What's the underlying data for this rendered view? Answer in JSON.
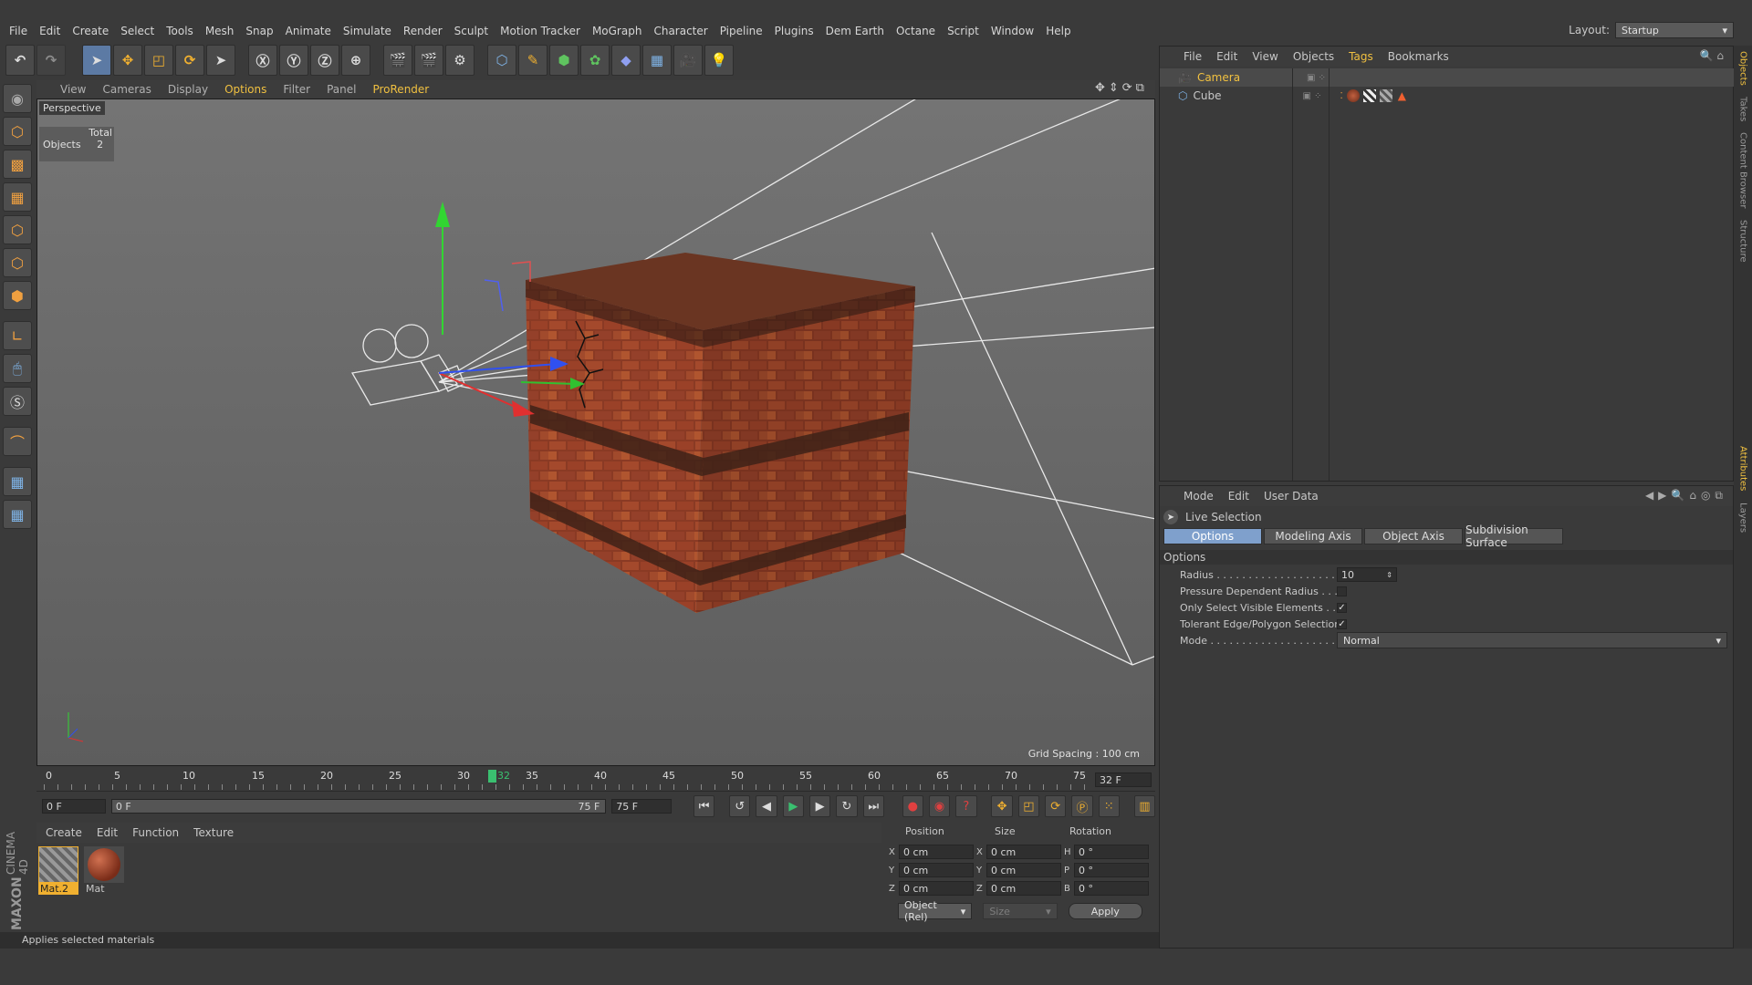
{
  "menu": [
    "File",
    "Edit",
    "Create",
    "Select",
    "Tools",
    "Mesh",
    "Snap",
    "Animate",
    "Simulate",
    "Render",
    "Sculpt",
    "Motion Tracker",
    "MoGraph",
    "Character",
    "Pipeline",
    "Plugins",
    "Dem Earth",
    "Octane",
    "Script",
    "Window",
    "Help"
  ],
  "layout": {
    "label": "Layout:",
    "value": "Startup"
  },
  "viewport": {
    "menu": [
      "View",
      "Cameras",
      "Display",
      "Options",
      "Filter",
      "Panel",
      "ProRender"
    ],
    "name": "Perspective",
    "stats_total": "Total",
    "stats_label": "Objects",
    "stats_value": "2",
    "grid": "Grid Spacing : 100 cm"
  },
  "objects": {
    "menu": [
      "File",
      "Edit",
      "View",
      "Objects",
      "Tags",
      "Bookmarks"
    ],
    "items": [
      "Camera",
      "Cube"
    ]
  },
  "attributes": {
    "menu": [
      "Mode",
      "Edit",
      "User Data"
    ],
    "tool": "Live Selection",
    "tabs": [
      "Options",
      "Modeling Axis",
      "Object Axis",
      "Subdivision Surface"
    ],
    "section": "Options",
    "radius_label": "Radius . . . . . . . . . . . . . . . . . . . . . .",
    "radius": "10",
    "pdr_label": "Pressure Dependent Radius . . . .",
    "osv_label": "Only Select Visible Elements . . .",
    "tep_label": "Tolerant Edge/Polygon Selection",
    "mode_label": "Mode . . . . . . . . . . . . . . . . . . . . . . .",
    "mode": "Normal"
  },
  "timeline": {
    "ticks": [
      "0",
      "5",
      "10",
      "15",
      "20",
      "25",
      "30",
      "35",
      "40",
      "45",
      "50",
      "55",
      "60",
      "65",
      "70",
      "75"
    ],
    "current": "32",
    "frame_display": "32 F",
    "start": "0 F",
    "range_start": "0 F",
    "range_end": "75 F",
    "end": "75 F"
  },
  "materials": {
    "menu": [
      "Create",
      "Edit",
      "Function",
      "Texture"
    ],
    "items": [
      "Mat.2",
      "Mat"
    ]
  },
  "coords": {
    "headers": [
      "Position",
      "Size",
      "Rotation"
    ],
    "rows": [
      [
        "X",
        "0 cm",
        "X",
        "0 cm",
        "H",
        "0 °"
      ],
      [
        "Y",
        "0 cm",
        "Y",
        "0 cm",
        "P",
        "0 °"
      ],
      [
        "Z",
        "0 cm",
        "Z",
        "0 cm",
        "B",
        "0 °"
      ]
    ],
    "mode": "Object (Rel)",
    "size": "Size",
    "apply": "Apply"
  },
  "status": "Applies selected materials",
  "brand": {
    "maxon": "MAXON",
    "cinema": "CINEMA 4D"
  },
  "side_tabs": [
    "Objects",
    "Takes",
    "Content Browser",
    "Structure"
  ],
  "side_tabs2": [
    "Attributes",
    "Layers"
  ]
}
